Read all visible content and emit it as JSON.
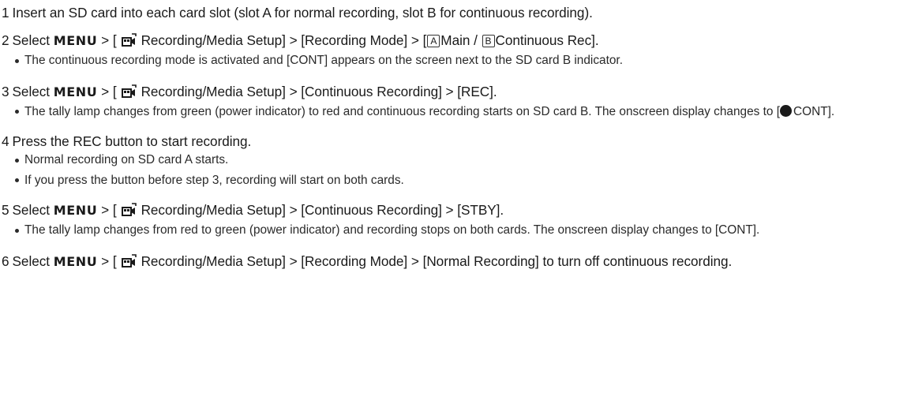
{
  "steps": [
    {
      "num": "1",
      "text": "Insert an SD card into each card slot (slot A for normal recording, slot B for continuous recording).",
      "bullets": []
    },
    {
      "num": "2",
      "pre": "Select",
      "menu": "MENU",
      "sep1": "> [",
      "path_a": "Recording/Media Setup] > [Recording Mode] > [",
      "box1": "A",
      "mid": "Main /",
      "box2": "B",
      "post": "Continuous Rec].",
      "bullets": [
        "The continuous recording mode is activated and [CONT] appears on the screen next to the SD card B indicator."
      ]
    },
    {
      "num": "3",
      "pre": "Select",
      "menu": "MENU",
      "sep1": "> [",
      "path_a": "Recording/Media Setup] > [Continuous Recording] > [REC].",
      "bullet_a": "The tally lamp changes from green (power indicator) to red and continuous recording starts on SD card B. The onscreen display changes to [",
      "bullet_b": "CONT]."
    },
    {
      "num": "4",
      "text": "Press the REC button to start recording.",
      "bullets": [
        "Normal recording on SD card A starts.",
        "If you press the button before step 3, recording will start on both cards."
      ]
    },
    {
      "num": "5",
      "pre": "Select",
      "menu": "MENU",
      "sep1": "> [",
      "path_a": "Recording/Media Setup] > [Continuous Recording] > [STBY].",
      "bullets": [
        "The tally lamp changes from red to green (power indicator) and recording stops on both cards. The onscreen display changes to [CONT]."
      ]
    },
    {
      "num": "6",
      "pre": "Select",
      "menu": "MENU",
      "sep1": "> [",
      "path_a": "Recording/Media Setup] > [Recording Mode] > [Normal Recording] to turn off continuous recording."
    }
  ],
  "icons": {
    "camera_setup": "camera-setup-icon",
    "record_dot": "record-dot-icon"
  }
}
